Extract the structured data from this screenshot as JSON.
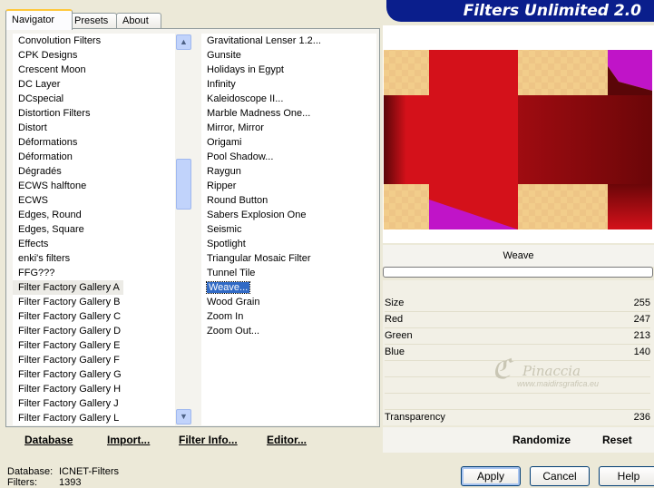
{
  "tabs": [
    {
      "label": "Navigator",
      "active": true
    },
    {
      "label": "Presets",
      "active": false
    },
    {
      "label": "About",
      "active": false
    }
  ],
  "title": "Filters Unlimited 2.0",
  "categories": [
    "Convolution Filters",
    "CPK Designs",
    "Crescent Moon",
    "DC Layer",
    "DCspecial",
    "Distortion Filters",
    "Distort",
    "Déformations",
    "Déformation",
    "Dégradés",
    "ECWS halftone",
    "ECWS",
    "Edges, Round",
    "Edges, Square",
    "Effects",
    "enki's filters",
    "FFG???",
    "Filter Factory Gallery A",
    "Filter Factory Gallery B",
    "Filter Factory Gallery C",
    "Filter Factory Gallery D",
    "Filter Factory Gallery E",
    "Filter Factory Gallery F",
    "Filter Factory Gallery G",
    "Filter Factory Gallery H",
    "Filter Factory Gallery J",
    "Filter Factory Gallery L"
  ],
  "selected_category": "Filter Factory Gallery A",
  "filters": [
    "Gravitational Lenser 1.2...",
    "Gunsite",
    "Holidays in Egypt",
    "Infinity",
    "Kaleidoscope II...",
    "Marble Madness One...",
    "Mirror, Mirror",
    "Origami",
    "Pool Shadow...",
    "Raygun",
    "Ripper",
    "Round Button",
    "Sabers Explosion One",
    "Seismic",
    "Spotlight",
    "Triangular Mosaic Filter",
    "Tunnel Tile",
    "Weave...",
    "Wood Grain",
    "Zoom In",
    "Zoom Out..."
  ],
  "selected_filter": "Weave...",
  "bottom_buttons": {
    "database": "Database",
    "import": "Import...",
    "filter_info": "Filter Info...",
    "editor": "Editor..."
  },
  "preview_name": "Weave",
  "params": [
    {
      "label": "Size",
      "value": "255"
    },
    {
      "label": "Red",
      "value": "247"
    },
    {
      "label": "Green",
      "value": "213"
    },
    {
      "label": "Blue",
      "value": "140"
    }
  ],
  "transparency": {
    "label": "Transparency",
    "value": "236"
  },
  "actions": {
    "randomize": "Randomize",
    "reset": "Reset",
    "apply": "Apply",
    "cancel": "Cancel",
    "help": "Help"
  },
  "status": {
    "database_label": "Database:",
    "database_value": "ICNET-Filters",
    "filters_label": "Filters:",
    "filters_value": "1393"
  },
  "watermark": {
    "name": "Pinaccia",
    "url": "www.maidirsgrafica.eu"
  },
  "colors": {
    "banner": "#0a1e8c",
    "preview_red": "#d4111a",
    "preview_tan": "#f2cd8b",
    "preview_magenta": "#c014c8",
    "selection": "#316ac5"
  }
}
